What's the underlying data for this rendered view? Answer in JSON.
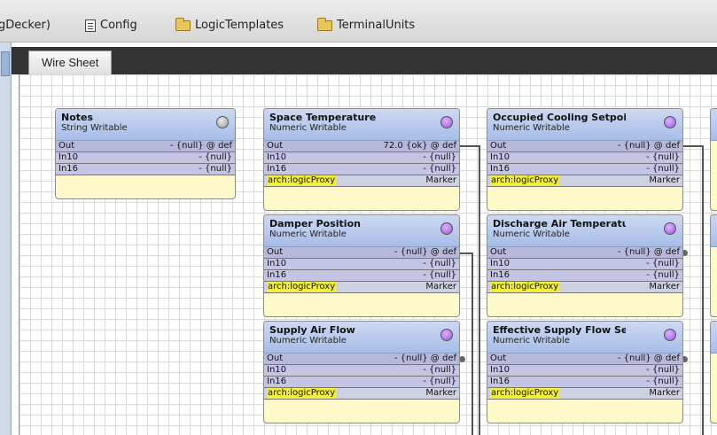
{
  "breadcrumb": {
    "partial": "gDecker)",
    "items": [
      {
        "label": "Config",
        "icon": "document-icon"
      },
      {
        "label": "LogicTemplates",
        "icon": "folder-icon"
      },
      {
        "label": "TerminalUnits",
        "icon": "folder-icon"
      }
    ]
  },
  "tab": {
    "label": "Wire Sheet"
  },
  "components": {
    "notes": {
      "title": "Notes",
      "type": "String Writable",
      "status": "grey",
      "slots": [
        {
          "name": "Out",
          "value": "- {null} @ def"
        },
        {
          "name": "In10",
          "value": "- {null}"
        },
        {
          "name": "In16",
          "value": "- {null}"
        }
      ]
    },
    "space_temp": {
      "title": "Space Temperature",
      "type": "Numeric Writable",
      "slots": [
        {
          "name": "Out",
          "value": "72.0 {ok} @ def"
        },
        {
          "name": "In10",
          "value": "- {null}"
        },
        {
          "name": "In16",
          "value": "- {null}"
        },
        {
          "name": "arch:logicProxy",
          "value": "Marker"
        }
      ]
    },
    "damper_pos": {
      "title": "Damper Position",
      "type": "Numeric Writable",
      "slots": [
        {
          "name": "Out",
          "value": "- {null} @ def"
        },
        {
          "name": "In10",
          "value": "- {null}"
        },
        {
          "name": "In16",
          "value": "- {null}"
        },
        {
          "name": "arch:logicProxy",
          "value": "Marker"
        }
      ]
    },
    "supply_air": {
      "title": "Supply Air Flow",
      "type": "Numeric Writable",
      "slots": [
        {
          "name": "Out",
          "value": "- {null} @ def"
        },
        {
          "name": "In10",
          "value": "- {null}"
        },
        {
          "name": "In16",
          "value": "- {null}"
        },
        {
          "name": "arch:logicProxy",
          "value": "Marker"
        }
      ]
    },
    "occ_cool": {
      "title": "Occupied Cooling Setpoin",
      "type": "Numeric Writable",
      "slots": [
        {
          "name": "Out",
          "value": "- {null} @ def"
        },
        {
          "name": "In10",
          "value": "- {null}"
        },
        {
          "name": "In16",
          "value": "- {null}"
        },
        {
          "name": "arch:logicProxy",
          "value": "Marker"
        }
      ]
    },
    "discharge_air": {
      "title": "Discharge Air Temperatu",
      "type": "Numeric Writable",
      "slots": [
        {
          "name": "Out",
          "value": "- {null} @ def"
        },
        {
          "name": "In10",
          "value": "- {null}"
        },
        {
          "name": "In16",
          "value": "- {null}"
        },
        {
          "name": "arch:logicProxy",
          "value": "Marker"
        }
      ]
    },
    "eff_supply": {
      "title": "Effective Supply Flow Set",
      "type": "Numeric Writable",
      "slots": [
        {
          "name": "Out",
          "value": "- {null} @ def"
        },
        {
          "name": "In10",
          "value": "- {null}"
        },
        {
          "name": "In16",
          "value": "- {null}"
        },
        {
          "name": "arch:logicProxy",
          "value": "Marker"
        }
      ]
    }
  }
}
